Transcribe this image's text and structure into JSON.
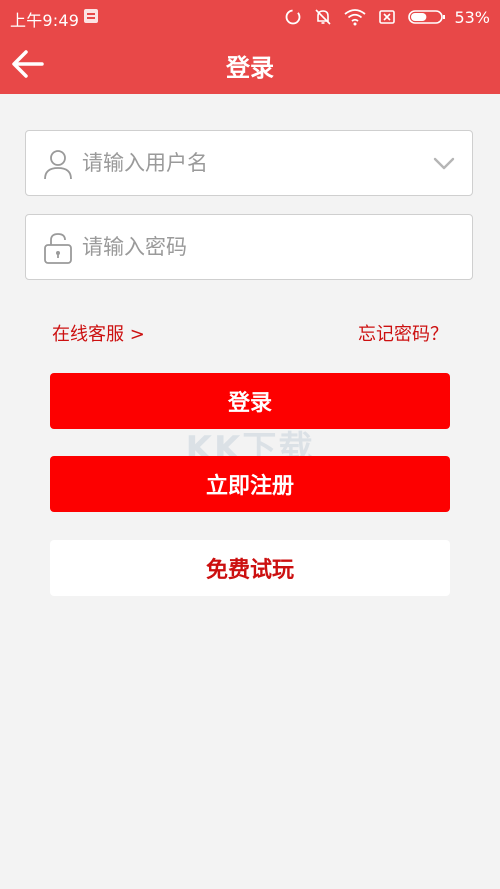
{
  "status_bar": {
    "time": "上午9:49",
    "battery_percent": "53%",
    "battery_level": 0.53,
    "icons": [
      "notification-icon",
      "sync-icon",
      "mute-bell-icon",
      "wifi-icon",
      "no-sim-icon",
      "battery-icon"
    ]
  },
  "nav": {
    "title": "登录",
    "back_icon": "arrow-left-icon"
  },
  "form": {
    "username": {
      "placeholder": "请输入用户名",
      "value": "",
      "icon": "user-icon",
      "dropdown_icon": "chevron-down-icon"
    },
    "password": {
      "placeholder": "请输入密码",
      "value": "",
      "icon": "lock-icon"
    }
  },
  "links": {
    "customer_service": "在线客服 >",
    "forgot_password": "忘记密码？"
  },
  "buttons": {
    "login": "登录",
    "register": "立即注册",
    "free_trial": "免费试玩"
  },
  "colors": {
    "header": "#e84848",
    "primary_button": "#fd0000",
    "link_text": "#cc1010",
    "background": "#f3f3f3"
  }
}
